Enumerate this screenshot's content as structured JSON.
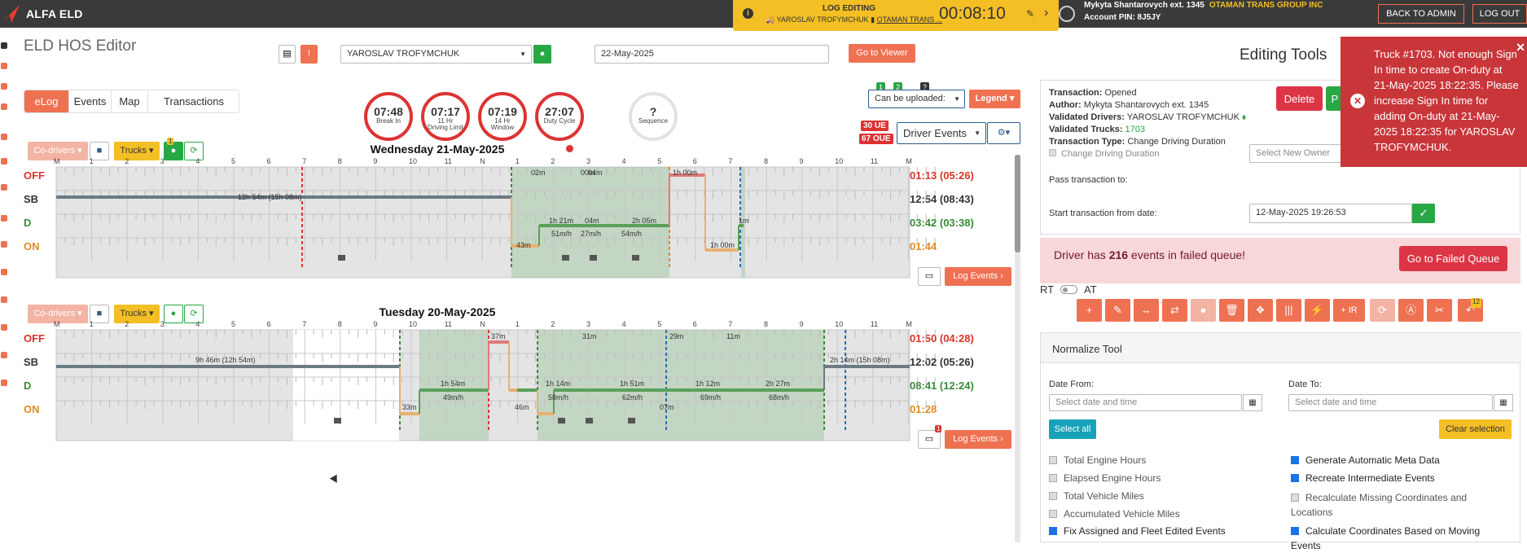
{
  "topbar": {
    "brand": "ALFA ELD",
    "log_editing_title": "LOG EDITING",
    "log_editing_sub_driver": "YAROSLAV TROFYMCHUK",
    "log_editing_sub_company": "OTAMAN TRANS ...",
    "timer": "00:08:10",
    "user_name": "Mykyta Shantarovych ext. 1345",
    "company": "OTAMAN TRANS GROUP INC",
    "account_pin": "Account PIN: 8J5JY",
    "back_to_admin": "BACK TO ADMIN",
    "log_out": "LOG OUT"
  },
  "header": {
    "title": "ELD HOS Editor",
    "driver_select": "YAROSLAV TROFYMCHUK",
    "date": "22-May-2025",
    "go_to_viewer": "Go to Viewer"
  },
  "tabs": [
    "eLog",
    "Events",
    "Map",
    "Transactions"
  ],
  "clocks": [
    {
      "value": "07:48",
      "label1": "Break In",
      "label2": ""
    },
    {
      "value": "07:17",
      "label1": "11 Hr",
      "label2": "Driving Limit"
    },
    {
      "value": "07:19",
      "label1": "14 Hr",
      "label2": "Window"
    },
    {
      "value": "27:07",
      "label1": "Duty Cycle",
      "label2": ""
    },
    {
      "value": "?",
      "label1": "Sequence",
      "label2": ""
    }
  ],
  "controls": {
    "can_be_uploaded": "Can be uploaded:",
    "legend": "Legend",
    "ue": "30 UE",
    "oue": "67 OUE",
    "driver_events": "Driver Events",
    "badge1": "1",
    "badge2": "2",
    "badge3": "?"
  },
  "chart_buttons": {
    "codrivers": "Co-drivers",
    "trucks": "Trucks",
    "log_events": "Log Events",
    "notif": "1"
  },
  "hours": [
    "M",
    "1",
    "2",
    "3",
    "4",
    "5",
    "6",
    "7",
    "8",
    "9",
    "10",
    "11",
    "N",
    "1",
    "2",
    "3",
    "4",
    "5",
    "6",
    "7",
    "8",
    "9",
    "10",
    "11",
    "M"
  ],
  "statuses": [
    "OFF",
    "SB",
    "D",
    "ON"
  ],
  "days": [
    {
      "title": "Wednesday 21-May-2025",
      "totals": [
        "01:13 (05:26)",
        "12:54 (08:43)",
        "03:42 (03:38)",
        "01:44"
      ],
      "labels": [
        "12h 54m (15h 08m)",
        "02m",
        "00m",
        "04m",
        "1h 00m",
        "1h 21m",
        "04m",
        "2h 05m",
        "51m/h",
        "27m/h",
        "54m/h",
        "43m",
        "1h 00m",
        "1m"
      ]
    },
    {
      "title": "Tuesday 20-May-2025",
      "totals": [
        "01:50 (04:28)",
        "12:02 (05:26)",
        "08:41 (12:24)",
        "01:28"
      ],
      "labels": [
        "9h 46m (12h 54m)",
        "37m",
        "31m",
        "29m",
        "11m",
        "2h 14m (15h 08m)",
        "1h 54m",
        "49m/h",
        "1h 14m",
        "58m/h",
        "1h 51m",
        "62m/h",
        "1h 12m",
        "69m/h",
        "2h 27m",
        "68m/h",
        "33m",
        "46m",
        "07m"
      ]
    }
  ],
  "editing_tools": {
    "title": "Editing Tools",
    "transaction": "Opened",
    "author": "Mykyta Shantarovych ext. 1345",
    "validated_drivers": "YAROSLAV TROFYMCHUK",
    "validated_trucks": "1703",
    "transaction_type": "Change Driving Duration",
    "change_driving": "Change Driving Duration",
    "delete": "Delete",
    "pass_transaction_to": "Pass transaction to:",
    "select_new_owner": "Select New Owner",
    "start_from_date": "Start transaction from date:",
    "start_date_value": "12-May-2025 19:26:53",
    "label_transaction": "Transaction:",
    "label_author": "Author:",
    "label_validated_drivers": "Validated Drivers:",
    "label_validated_trucks": "Validated Trucks:",
    "label_transaction_type": "Transaction Type:"
  },
  "failed_queue": {
    "text_pre": "Driver has ",
    "count": "216",
    "text_post": " events in failed queue!",
    "button": "Go to Failed Queue"
  },
  "rt_at": {
    "rt": "RT",
    "at": "AT"
  },
  "toolbar": {
    "ir_label": "+ IR",
    "badge": "12"
  },
  "normalize": {
    "title": "Normalize Tool",
    "date_from": "Date From:",
    "date_to": "Date To:",
    "placeholder": "Select date and time",
    "select_all": "Select all",
    "clear_selection": "Clear selection",
    "left_options": [
      "Total Engine Hours",
      "Elapsed Engine Hours",
      "Total Vehicle Miles",
      "Accumulated Vehicle Miles",
      "Fix Assigned and Fleet Edited Events"
    ],
    "right_options": [
      "Generate Automatic Meta Data",
      "Recreate Intermediate Events",
      "Recalculate Missing Coordinates and Locations",
      "Calculate Coordinates Based on Moving Events"
    ]
  },
  "toast": {
    "message": "Truck #1703. Not enough Sign In time to create On-duty at 21-May-2025 18:22:35. Please increase Sign In time for adding On-duty at 21-May-2025 18:22:35 for YAROSLAV TROFYMCHUK."
  },
  "colors": {
    "accent": "#ee7152",
    "off": "#d9342b",
    "sb": "#333333",
    "d": "#3a8a3a",
    "on": "#e08a1e",
    "green": "#28a745",
    "yellow": "#f3bf24"
  }
}
